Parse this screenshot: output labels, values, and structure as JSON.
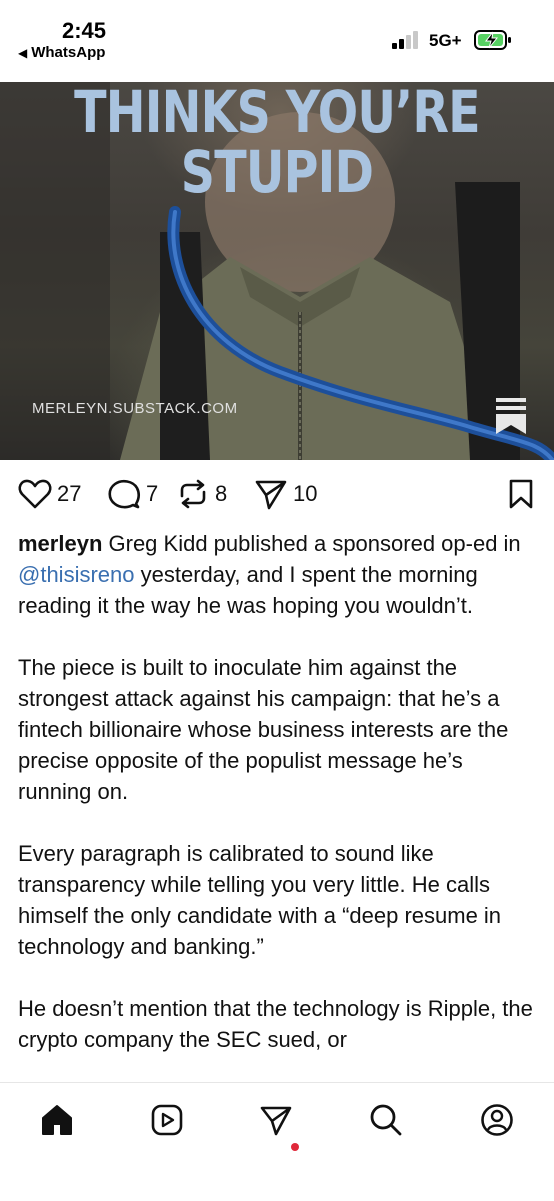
{
  "status_bar": {
    "time": "2:45",
    "back_app": "WhatsApp",
    "network": "5G+"
  },
  "post_image": {
    "headline_lines": [
      "THINKS YOU’RE",
      "STUPID"
    ],
    "source_url": "MERLEYN.SUBSTACK.COM",
    "icon": "substack-bookmark-icon"
  },
  "actions": {
    "likes": "27",
    "comments": "7",
    "reposts": "8",
    "shares": "10"
  },
  "caption": {
    "username": "merleyn",
    "p1_before_mention": " Greg Kidd published a sponsored op-ed in ",
    "mention": "@thisisreno",
    "p1_after_mention": " yesterday, and I spent the morning reading it the way he was hoping you wouldn’t.",
    "p2": "The piece is built to inoculate him against the strongest attack against his campaign: that he’s a fintech billionaire whose business interests are the precise opposite of the populist message he’s running on.",
    "p3": "Every paragraph is calibrated to sound like transparency while telling you very little. He calls himself the only candidate with a “deep resume in technology and banking.”",
    "p4": "He doesn’t mention that the technology is Ripple, the crypto company the SEC sued, or"
  },
  "tab_bar": {
    "tabs": [
      "home-icon",
      "reels-icon",
      "messages-icon",
      "search-icon",
      "profile-icon"
    ],
    "notification_dot_color": "#e0283a"
  },
  "colors": {
    "headline": "#a9c3df",
    "mention": "#3a6fb0"
  }
}
